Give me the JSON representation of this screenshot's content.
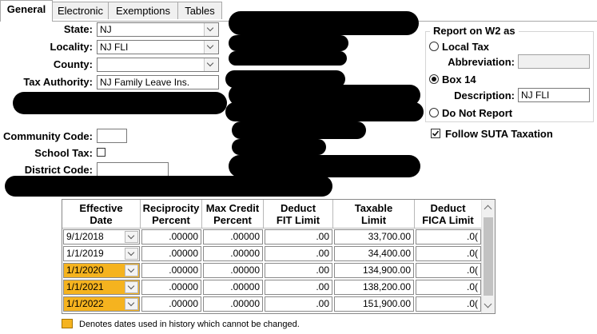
{
  "tabs": [
    {
      "label": "General"
    },
    {
      "label": "Electronic"
    },
    {
      "label": "Exemptions"
    },
    {
      "label": "Tables"
    }
  ],
  "form": {
    "state_label": "State:",
    "state_value": "NJ",
    "locality_label": "Locality:",
    "locality_value": "NJ FLI",
    "county_label": "County:",
    "county_value": "",
    "tax_authority_label": "Tax Authority:",
    "tax_authority_value": "NJ Family Leave Ins.",
    "community_code_label": "Community Code:",
    "community_code_value": "",
    "school_tax_label": "School Tax:",
    "school_tax_checked": false,
    "district_code_label": "District Code:",
    "district_code_value": ""
  },
  "report_w2": {
    "title": "Report on W2 as",
    "local_tax_label": "Local Tax",
    "abbreviation_label": "Abbreviation:",
    "abbreviation_value": "",
    "box14_label": "Box 14",
    "description_label": "Description:",
    "description_value": "NJ FLI",
    "do_not_report_label": "Do Not Report",
    "selected": "Box 14",
    "follow_suta_label": "Follow SUTA Taxation",
    "follow_suta_checked": true
  },
  "table": {
    "headers": [
      {
        "line1": "Effective",
        "line2": "Date"
      },
      {
        "line1": "Reciprocity",
        "line2": "Percent"
      },
      {
        "line1": "Max Credit",
        "line2": "Percent"
      },
      {
        "line1": "Deduct",
        "line2": "FIT Limit"
      },
      {
        "line1": "Taxable",
        "line2": "Limit"
      },
      {
        "line1": "Deduct",
        "line2": "FICA Limit"
      }
    ],
    "rows": [
      {
        "date": "9/1/2018",
        "history": false,
        "reciprocity": ".00000",
        "max_credit": ".00000",
        "fit_limit": ".00",
        "taxable_limit": "33,700.00",
        "fica_limit": ".0("
      },
      {
        "date": "1/1/2019",
        "history": false,
        "reciprocity": ".00000",
        "max_credit": ".00000",
        "fit_limit": ".00",
        "taxable_limit": "34,400.00",
        "fica_limit": ".0("
      },
      {
        "date": "1/1/2020",
        "history": true,
        "reciprocity": ".00000",
        "max_credit": ".00000",
        "fit_limit": ".00",
        "taxable_limit": "134,900.00",
        "fica_limit": ".0("
      },
      {
        "date": "1/1/2021",
        "history": true,
        "reciprocity": ".00000",
        "max_credit": ".00000",
        "fit_limit": ".00",
        "taxable_limit": "138,200.00",
        "fica_limit": ".0("
      },
      {
        "date": "1/1/2022",
        "history": true,
        "reciprocity": ".00000",
        "max_credit": ".00000",
        "fit_limit": ".00",
        "taxable_limit": "151,900.00",
        "fica_limit": ".0("
      }
    ]
  },
  "legend": {
    "text": "Denotes dates used in history which cannot be changed.",
    "color": "#f5b31f"
  }
}
